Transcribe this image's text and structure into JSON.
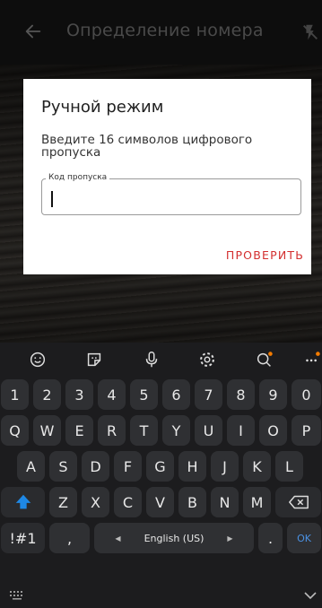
{
  "app_bar": {
    "title": "Определение номера",
    "back_icon": "arrow-left-icon",
    "flash_icon": "flash-off-icon"
  },
  "dialog": {
    "title": "Ручной режим",
    "description": "Введите 16 символов цифрового пропуска",
    "field_label": "Код пропуска",
    "field_value": "",
    "verify_button": "ПРОВЕРИТЬ"
  },
  "colors": {
    "accent": "#d32f2f",
    "keyboard_bg": "#1c1c1e",
    "key_bg": "#2f3033",
    "shift_active": "#1e88e5",
    "ok_text": "#4a90e2"
  },
  "keyboard": {
    "toolbar_icons": [
      "emoji-icon",
      "sticker-icon",
      "microphone-icon",
      "settings-icon",
      "search-icon",
      "more-icon"
    ],
    "number_row": [
      "1",
      "2",
      "3",
      "4",
      "5",
      "6",
      "7",
      "8",
      "9",
      "0"
    ],
    "row1": [
      "Q",
      "W",
      "E",
      "R",
      "T",
      "Y",
      "U",
      "I",
      "O",
      "P"
    ],
    "row2": [
      "A",
      "S",
      "D",
      "F",
      "G",
      "H",
      "J",
      "K",
      "L"
    ],
    "row3": [
      "Z",
      "X",
      "C",
      "V",
      "B",
      "N",
      "M"
    ],
    "symbols_key": "!#1",
    "comma_key": ",",
    "space_label": "English (US)",
    "period_key": ".",
    "ok_key": "OK",
    "shift_icon": "shift-icon",
    "backspace_icon": "backspace-icon"
  },
  "nav_bar": {
    "keyboard_icon": "keyboard-grid-icon",
    "collapse_icon": "chevron-down-icon"
  }
}
